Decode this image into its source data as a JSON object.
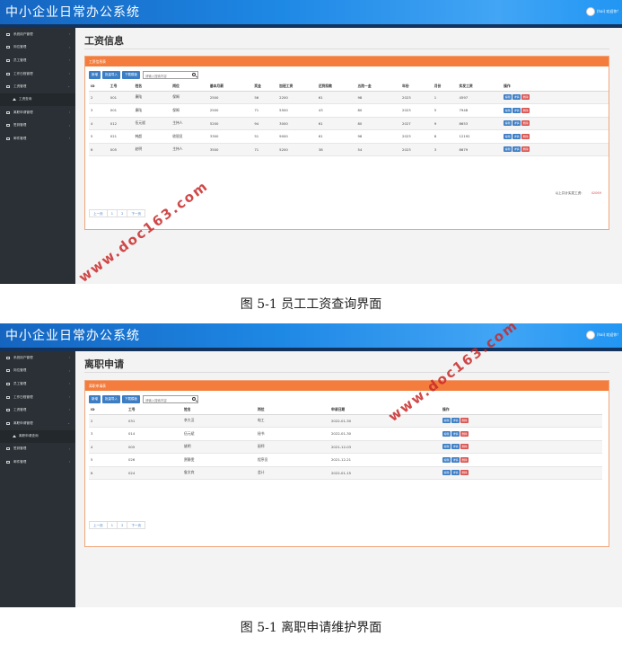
{
  "app": {
    "title": "中小企业日常办公系统",
    "user": "(hai) 欢迎你!"
  },
  "sidebar": {
    "items": [
      "系统用户管理",
      "岗位管理",
      "员工管理",
      "工作日程管理",
      "工资管理",
      "离职申请管理",
      "签到管理",
      "邮件管理"
    ]
  },
  "screen1": {
    "sub_item": "工资查询",
    "page_title": "工资信息",
    "panel_title": "工资信息表",
    "toolbar": {
      "add": "新增",
      "import": "批量导入",
      "template": "下载模板",
      "search_placeholder": "请输入搜索内容"
    },
    "columns": [
      "ID",
      "工号",
      "姓名",
      "岗位",
      "基本月薪",
      "奖金",
      "加班工资",
      "迟到扣款",
      "五险一金",
      "年份",
      "月份",
      "实发工资",
      "操作"
    ],
    "rows": [
      [
        "2",
        "001",
        "康陆",
        "保姆",
        "2500",
        "56",
        "2200",
        "61",
        "98",
        "2023",
        "1",
        "4597"
      ],
      [
        "3",
        "001",
        "康陆",
        "保姆",
        "2500",
        "71",
        "5500",
        "43",
        "80",
        "2023",
        "5",
        "7948"
      ],
      [
        "4",
        "012",
        "伍元斌",
        "主持人",
        "5200",
        "94",
        "3000",
        "61",
        "80",
        "2027",
        "9",
        "8653"
      ],
      [
        "5",
        "021",
        "韩超",
        "收银员",
        "3300",
        "51",
        "9000",
        "61",
        "98",
        "2023",
        "8",
        "12192"
      ],
      [
        "6",
        "005",
        "赵明",
        "主持人",
        "3500",
        "71",
        "5200",
        "38",
        "54",
        "2023",
        "3",
        "8679"
      ]
    ],
    "ops": {
      "edit": "编辑",
      "view": "详情",
      "del": "删除"
    },
    "total_label": "以上共计实发工资:",
    "total_value": "42069",
    "pager": [
      "上一页",
      "1",
      "2",
      "下一页"
    ],
    "caption": "图 5-1  员工工资查询界面"
  },
  "screen2": {
    "sub_item": "离职申请查询",
    "page_title": "离职申请",
    "panel_title": "离职申请表",
    "toolbar": {
      "add": "新增",
      "import": "批量导入",
      "template": "下载模板",
      "search_placeholder": "请输入搜索内容"
    },
    "columns": [
      "ID",
      "工号",
      "姓名",
      "岗位",
      "申请日期",
      "操作"
    ],
    "rows": [
      [
        "2",
        "031",
        "李大汉",
        "电工",
        "2022-01-30"
      ],
      [
        "3",
        "014",
        "伍元斌",
        "秘书",
        "2022-01-30"
      ],
      [
        "4",
        "005",
        "姚明",
        "厨师",
        "2021-12-03"
      ],
      [
        "5",
        "026",
        "贾静雯",
        "程序员",
        "2021-12-21"
      ],
      [
        "6",
        "024",
        "鲁文宾",
        "会计",
        "2022-01-15"
      ]
    ],
    "ops": {
      "edit": "编辑",
      "view": "详情",
      "del": "删除"
    },
    "pager": [
      "上一页",
      "1",
      "2",
      "下一页"
    ],
    "caption": "图 5-1  离职申请维护界面"
  },
  "watermark": "www.doc163.com"
}
